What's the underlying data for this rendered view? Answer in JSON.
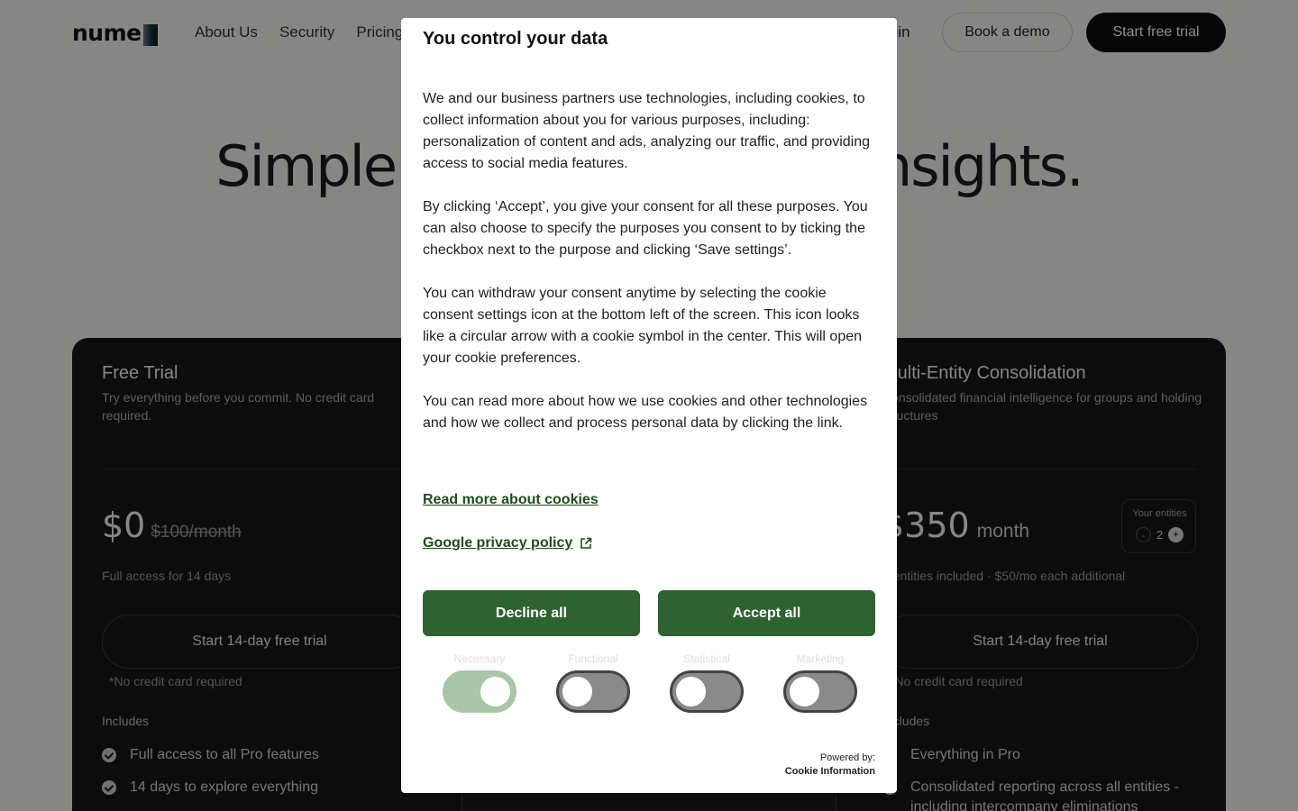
{
  "nav": {
    "logo_text": "nume",
    "links": [
      "About Us",
      "Security",
      "Pricing"
    ],
    "login": "Login",
    "book_demo": "Book a demo",
    "start_trial": "Start free trial"
  },
  "hero": {
    "title": "Simple pricing. Powerful insights."
  },
  "plans": [
    {
      "title": "Free Trial",
      "subtitle": "Try everything before you commit. No credit card required.",
      "price": "$0",
      "price_strike": "$100/month",
      "note": "Full access for 14 days",
      "cta": "Start 14-day free trial",
      "no_cc": "*No credit card required",
      "includes": "Includes",
      "features": [
        "Full access to all Pro features",
        "14 days to explore everything"
      ]
    },
    {
      "title": "Multi-Entity Consolidation",
      "subtitle": "Consolidated financial intelligence for groups and holding structures",
      "price": "$350",
      "per": "month",
      "entities_label": "Your entities",
      "entities_minus": "-",
      "entities_count": "2",
      "entities_plus": "+",
      "note": "2 entities included · $50/mo each additional",
      "cta": "Start 14-day free trial",
      "no_cc": "*No credit card required",
      "includes": "Includes",
      "features": [
        "Everything in Pro",
        "Consolidated reporting across all entities - including intercompany eliminations"
      ]
    }
  ],
  "consent": {
    "title": "You control your data",
    "paragraphs": [
      "We and our business partners use technologies, including cookies, to collect information about you for various purposes, including: personalization of content and ads, analyzing our traffic, and providing access to social media features.",
      "By clicking ‘Accept’, you give your consent for all these purposes. You can also choose to specify the purposes you consent to by ticking the checkbox next to the purpose and clicking ‘Save settings’.",
      "You can withdraw your consent anytime by selecting the cookie consent settings icon at the bottom left of the screen. This icon looks like a circular arrow with a cookie symbol in the center. This will open your cookie preferences.",
      "You can read more about how we use cookies and other technologies and how we collect and process personal data by clicking the link."
    ],
    "link_cookies": "Read more about cookies",
    "link_google": "Google privacy policy",
    "decline": "Decline all",
    "accept": "Accept all",
    "toggles": [
      {
        "label": "Necessary",
        "on": true
      },
      {
        "label": "Functional",
        "on": false
      },
      {
        "label": "Statistical",
        "on": false
      },
      {
        "label": "Marketing",
        "on": false
      }
    ],
    "powered_by": "Powered by:",
    "powered_brand": "Cookie Information",
    "colors": {
      "button": "#2e6230",
      "link": "#1f4d1f",
      "toggle_on": "#a9c6a8"
    }
  }
}
